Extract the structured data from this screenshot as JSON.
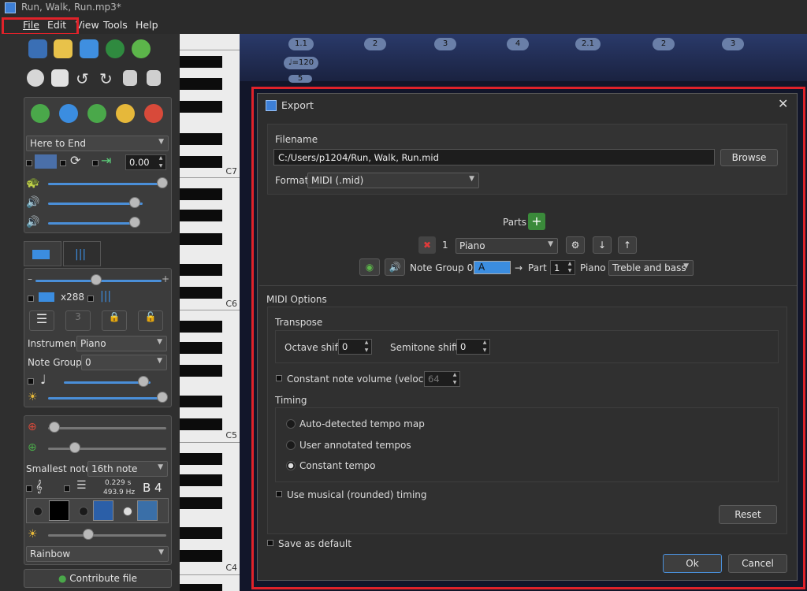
{
  "window": {
    "title": "Run, Walk, Run.mp3*"
  },
  "menu": {
    "items": [
      "File",
      "Edit",
      "View",
      "Tools",
      "Help"
    ]
  },
  "left": {
    "playback_range": "Here to End",
    "speed_value": "0.00",
    "tab_icons": [
      "note-label-tab",
      "bars-tab"
    ],
    "note_count": "x288",
    "instrument_label": "Instrument",
    "instrument": "Piano",
    "note_group_label": "Note Group",
    "note_group": "0",
    "smallest_note_label": "Smallest note",
    "smallest_note": "16th note",
    "time_value": "0.229 s",
    "freq_value": "493.9 Hz",
    "note_name": "B 4",
    "color_scheme": "Rainbow",
    "contribute": "Contribute file"
  },
  "piano": {
    "labels": [
      "C7",
      "C6",
      "C5",
      "C4"
    ]
  },
  "roll": {
    "bars": [
      "1.1",
      "2",
      "3",
      "4",
      "2.1",
      "2",
      "3"
    ],
    "tempo": "♩=120",
    "mini": "5"
  },
  "dialog": {
    "title": "Export",
    "filename_label": "Filename",
    "filename": "C:/Users/p1204/Run, Walk, Run.mid",
    "browse": "Browse",
    "format_label": "Format",
    "format": "MIDI (.mid)",
    "parts_label": "Parts",
    "part_number": "1",
    "part_instrument": "Piano",
    "note_group_label": "Note Group 0",
    "arrow": "→",
    "part_label": "Part",
    "part_value": "1",
    "part_instrument_name": "Piano",
    "clef": "Treble and bass",
    "midi_options": "MIDI Options",
    "transpose": "Transpose",
    "octave_shift_label": "Octave shift",
    "octave_shift": "0",
    "semitone_shift_label": "Semitone shift",
    "semitone_shift": "0",
    "constant_volume": "Constant note volume (velocity):",
    "velocity": "64",
    "timing": "Timing",
    "timing_options": [
      "Auto-detected tempo map",
      "User annotated tempos",
      "Constant tempo"
    ],
    "selected_timing": 2,
    "musical_timing": "Use musical (rounded) timing",
    "reset": "Reset",
    "save_default": "Save as default",
    "ok": "Ok",
    "cancel": "Cancel"
  },
  "colors": {
    "accent": "#4a8fd9",
    "highlight": "#e0222a",
    "dialog_bg": "#2d2d2d"
  }
}
